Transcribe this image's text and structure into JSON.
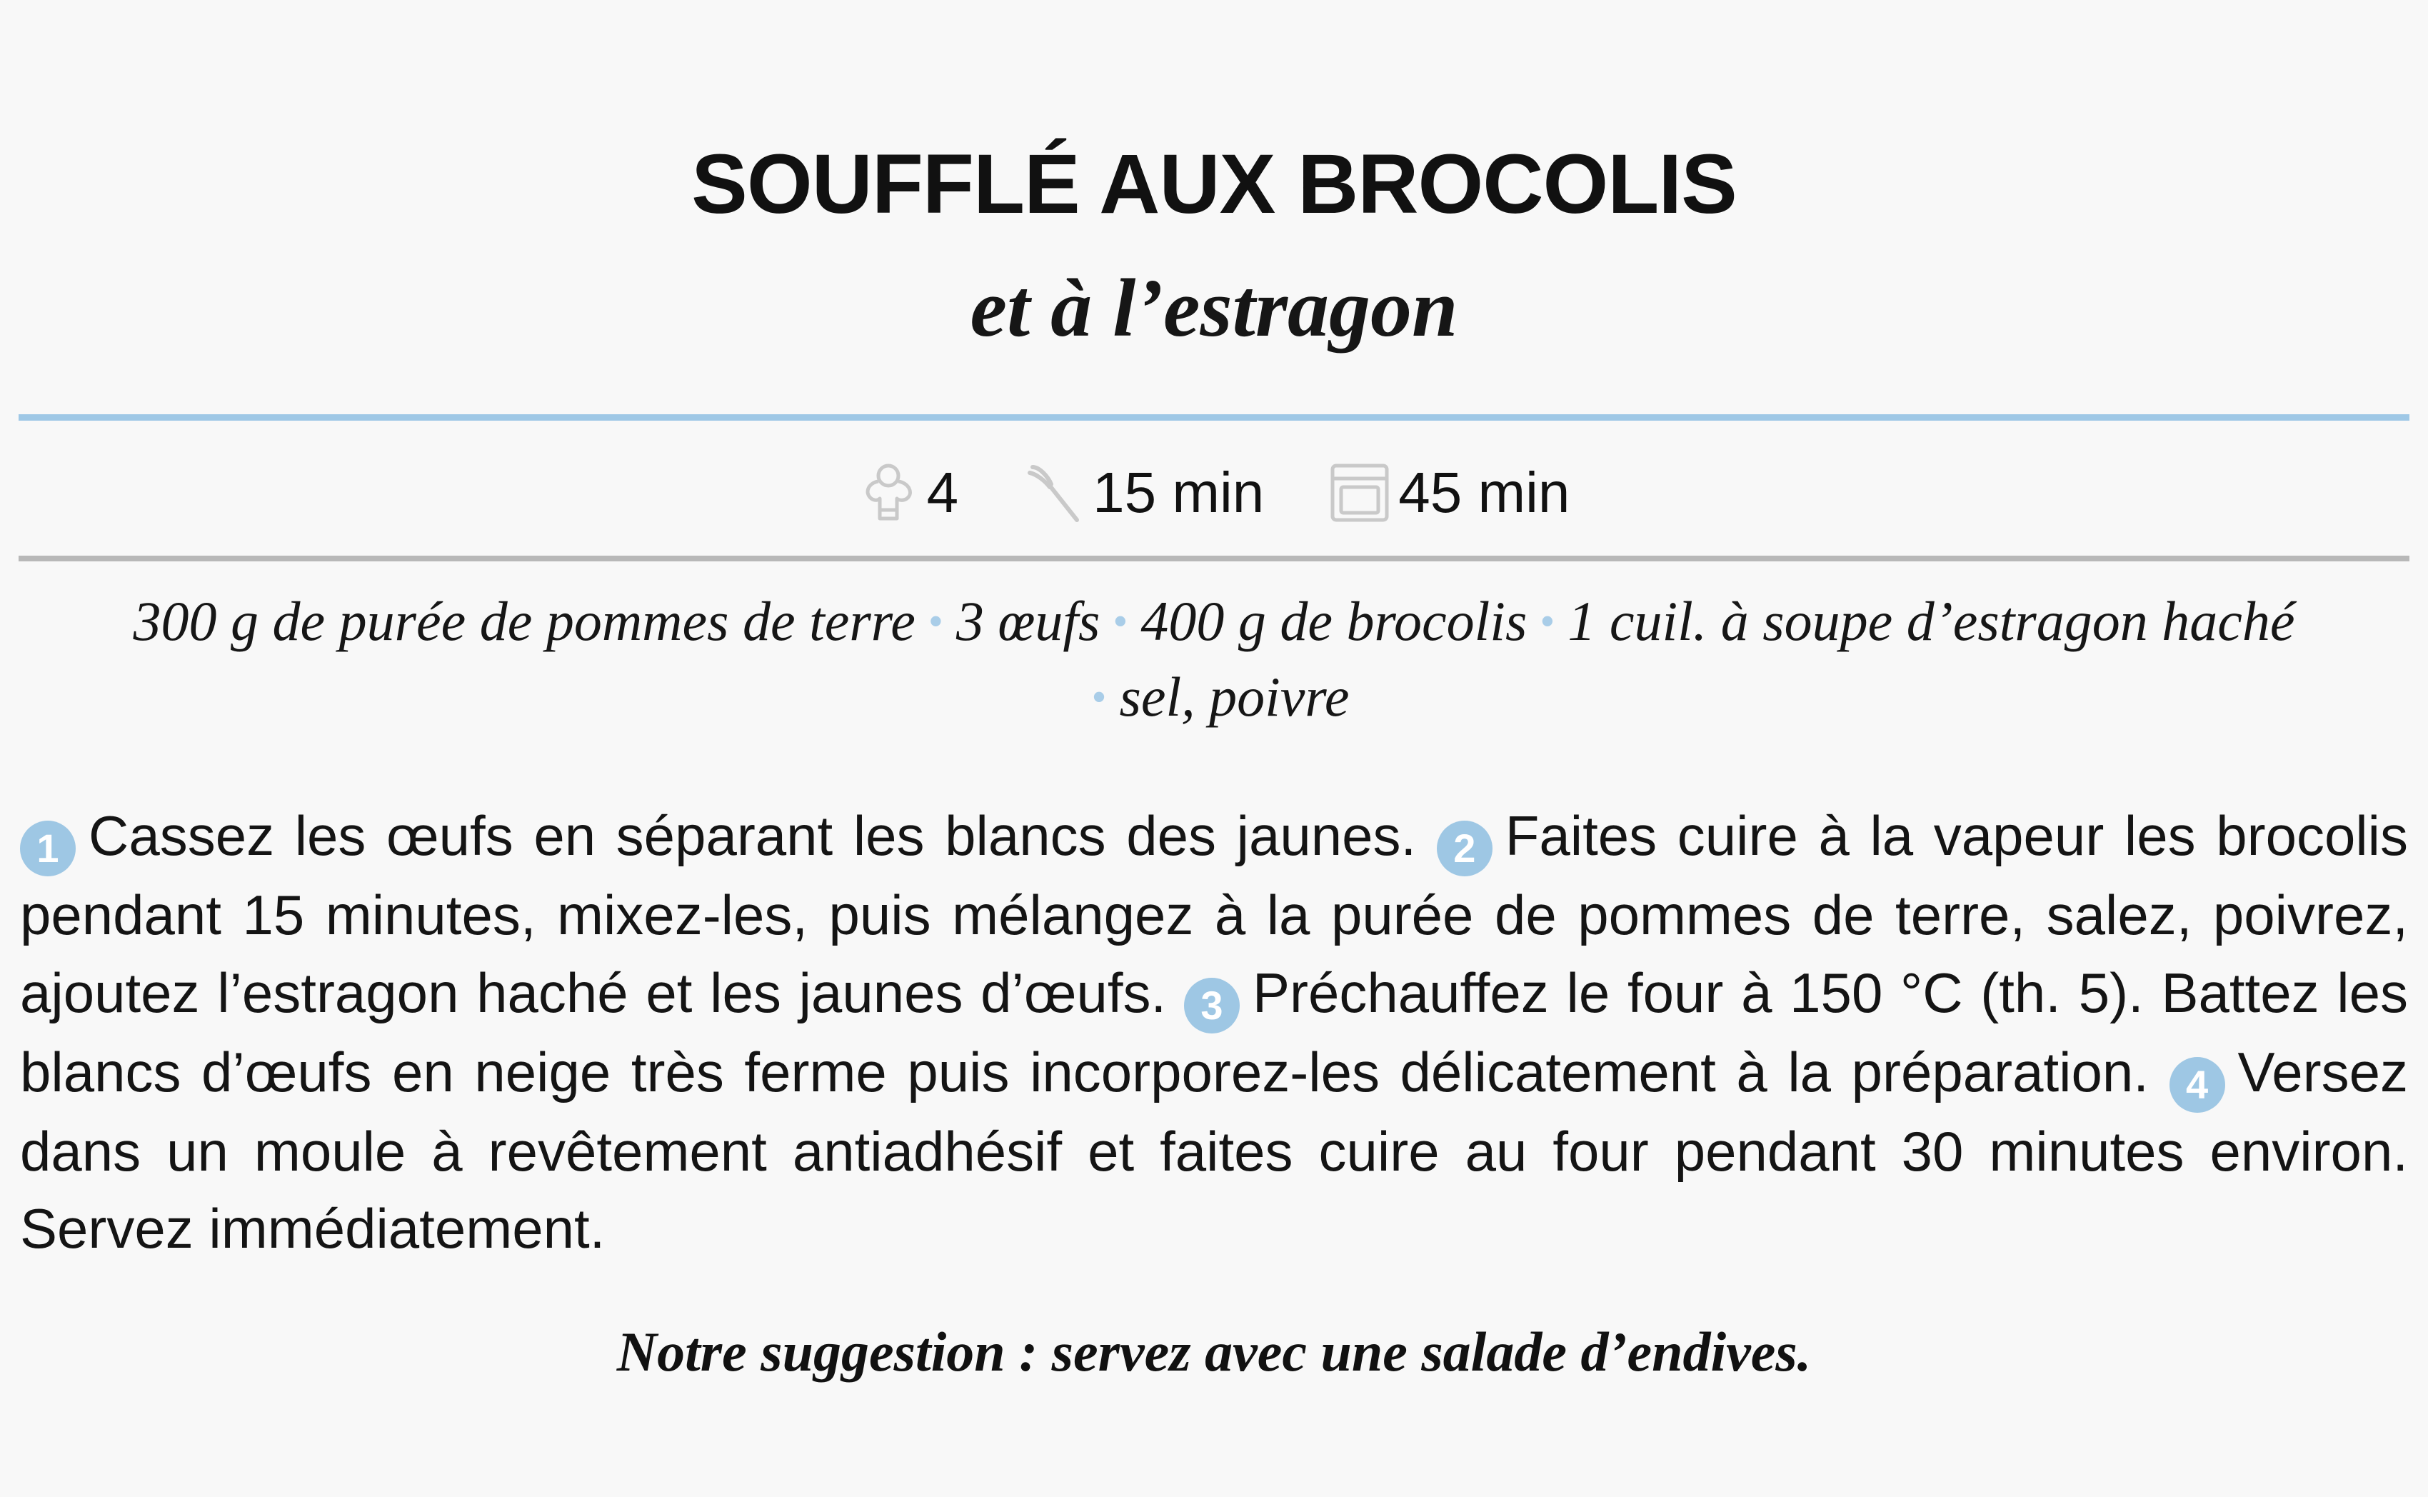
{
  "recipe": {
    "title": "SOUFFLÉ AUX BROCOLIS",
    "subtitle": "et à l’estragon"
  },
  "meta": {
    "servings": {
      "icon": "chef-hat-icon",
      "value": "4"
    },
    "prep": {
      "icon": "whisk-icon",
      "value": "15 min"
    },
    "cook": {
      "icon": "oven-icon",
      "value": "45 min"
    }
  },
  "ingredients": [
    "300 g de purée de pommes de terre",
    "3 œufs",
    "400 g de brocolis",
    "1 cuil. à soupe d’estragon haché",
    "sel, poivre"
  ],
  "steps": [
    {
      "number": "1",
      "text": "Cassez les œufs en séparant les blancs des jaunes."
    },
    {
      "number": "2",
      "text": "Faites cuire à la vapeur les brocolis pendant 15 minutes, mixez-les, puis mélangez à la purée de pommes de terre, salez, poivrez, ajoutez l’estragon haché et les jaunes d’œufs."
    },
    {
      "number": "3",
      "text": "Préchauffez le four à 150 °C (th. 5). Battez les blancs d’œufs en neige très ferme puis incorporez-les délicatement à la préparation."
    },
    {
      "number": "4",
      "text": "Versez dans un moule à revêtement antiadhésif et faites cuire au four pendant 30 minutes environ. Servez immédiatement."
    }
  ],
  "suggestion": "Notre suggestion : servez avec une salade d’endives.",
  "colors": {
    "accent": "#9ec7e4",
    "rule_top": "#9fc8e6",
    "rule_bottom": "#b8b8b8",
    "icon": "#c9c9c9",
    "separator": "#a9cde8"
  }
}
